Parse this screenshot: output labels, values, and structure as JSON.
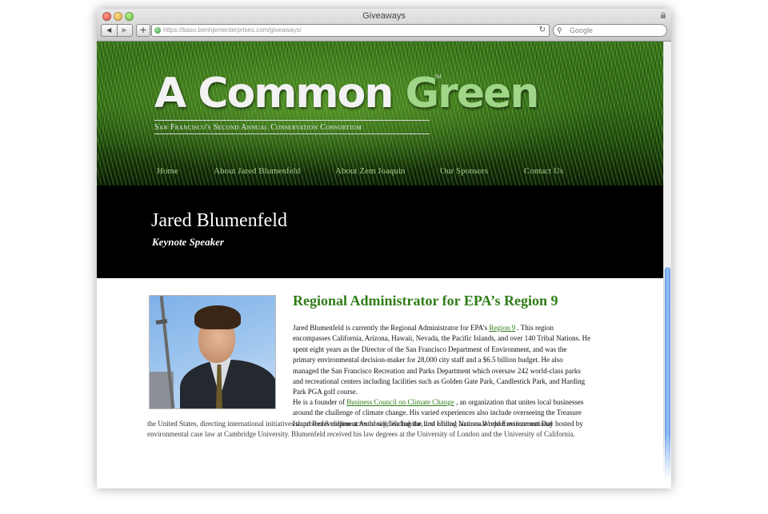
{
  "browser": {
    "window_title": "Giveaways",
    "url": "https://baso.benhjementerprises.com/giveaways/",
    "back_label": "◀",
    "forward_label": "▶",
    "add_label": "+",
    "reload_label": "↻",
    "search_placeholder": "Google",
    "search_icon": "magnifier-icon"
  },
  "site": {
    "logo": {
      "title_white": "A Common ",
      "title_green": "Green",
      "tm": "TM",
      "subtitle": "San Francisco's Second Annual Conservation Consortium"
    },
    "nav": [
      {
        "label": "Home"
      },
      {
        "label": "About Jared Blumenfeld"
      },
      {
        "label": "About Zem Joaquin"
      },
      {
        "label": "Our Sponsors"
      },
      {
        "label": "Contact Us"
      }
    ],
    "hero": {
      "name": "Jared Blumenfeld",
      "role": "Keynote Speaker"
    }
  },
  "article": {
    "heading": "Regional Administrator for EPA’s Region 9",
    "para1": {
      "line1_before": "Jared Blumenfeld is currently the Regional Administrator for EPA’s ",
      "line1_link": "Region 9",
      "line1_after": " . This region",
      "lines": [
        "encompasses California, Arizona, Hawaii, Nevada, the Pacific Islands, and over 140 Tribal Nations. He",
        "spent eight years as the Director of the San Francisco Department of Environment, and was the",
        "primary environmental decision-maker for 28,000 city staff and a $6.5 billion budget. He also",
        "managed the San Francisco Recreation and Parks Department which oversaw 242 world-class parks",
        "and recreational centers including facilities such as Golden Gate Park, Candlestick Park, and Harding",
        "Park PGA golf course."
      ]
    },
    "para2": {
      "line1_before": "He is a founder of ",
      "line1_link": "Business Council on Climate Change",
      "line1_after": " , an organization that unites local businesses",
      "lines": [
        "around the challenge of climate change. His varied experiences also include overseeing the Treasure",
        "Island Redevelopment Authority, leading the first United Nations World Environment Day hosted by"
      ],
      "wide_lines": [
        "the United States, directing international initiatives to protect 8 million acres of wildlife habitat, and editing an annual report on international",
        "environmental case law at Cambridge University. Blumenfeld received his law degrees at the University of London and the University of California."
      ]
    }
  }
}
